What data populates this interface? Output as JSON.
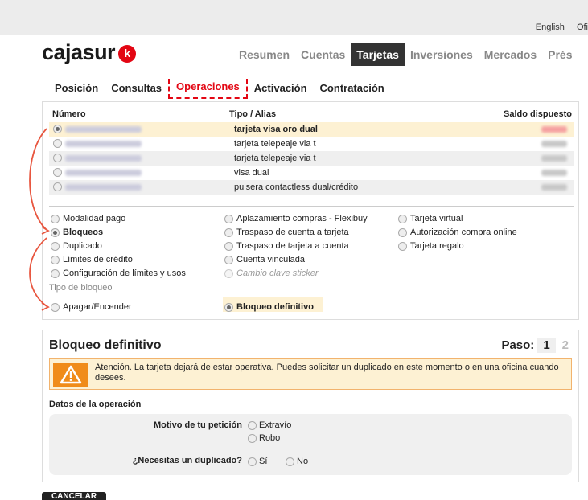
{
  "top_links": [
    "English",
    "Ofi"
  ],
  "brand": {
    "name": "cajasur",
    "badge": "k",
    "accent": "#e30613"
  },
  "main_nav": [
    "Resumen",
    "Cuentas",
    "Tarjetas",
    "Inversiones",
    "Mercados",
    "Prés"
  ],
  "main_nav_active": "Tarjetas",
  "sub_nav": [
    "Posición",
    "Consultas",
    "Operaciones",
    "Activación",
    "Contratación"
  ],
  "sub_nav_active": "Operaciones",
  "table": {
    "headers": {
      "numero": "Número",
      "tipo": "Tipo / Alias",
      "saldo": "Saldo dispuesto"
    },
    "rows": [
      {
        "alias": "tarjeta visa oro dual",
        "selected": true
      },
      {
        "alias": "tarjeta telepeaje via t",
        "selected": false
      },
      {
        "alias": "tarjeta telepeaje via t",
        "selected": false
      },
      {
        "alias": "visa dual",
        "selected": false
      },
      {
        "alias": "pulsera contactless dual/crédito",
        "selected": false
      }
    ]
  },
  "operations": {
    "col1": [
      "Modalidad pago",
      "Bloqueos",
      "Duplicado",
      "Límites de crédito",
      "Configuración de límites y usos"
    ],
    "col2": [
      "Aplazamiento compras - Flexibuy",
      "Traspaso de cuenta a tarjeta",
      "Traspaso de tarjeta a cuenta",
      "Cuenta vinculada",
      "Cambio clave sticker"
    ],
    "col3": [
      "Tarjeta virtual",
      "Autorización compra online",
      "Tarjeta regalo"
    ],
    "selected": "Bloqueos"
  },
  "block_type": {
    "legend": "Tipo de bloqueo",
    "options": [
      "Apagar/Encender",
      "Bloqueo definitivo"
    ],
    "selected": "Bloqueo definitivo"
  },
  "detail": {
    "title": "Bloqueo definitivo",
    "step_label": "Paso:",
    "step_current": "1",
    "step_next": "2",
    "warning": "Atención. La tarjeta dejará de estar operativa. Puedes solicitar un duplicado en este momento o en una oficina cuando desees.",
    "section": "Datos de la operación",
    "reason_label": "Motivo de tu petición",
    "reason_options": [
      "Extravío",
      "Robo"
    ],
    "duplicate_label": "¿Necesitas un duplicado?",
    "duplicate_options": [
      "Sí",
      "No"
    ]
  },
  "cancel_label": "CANCELAR"
}
